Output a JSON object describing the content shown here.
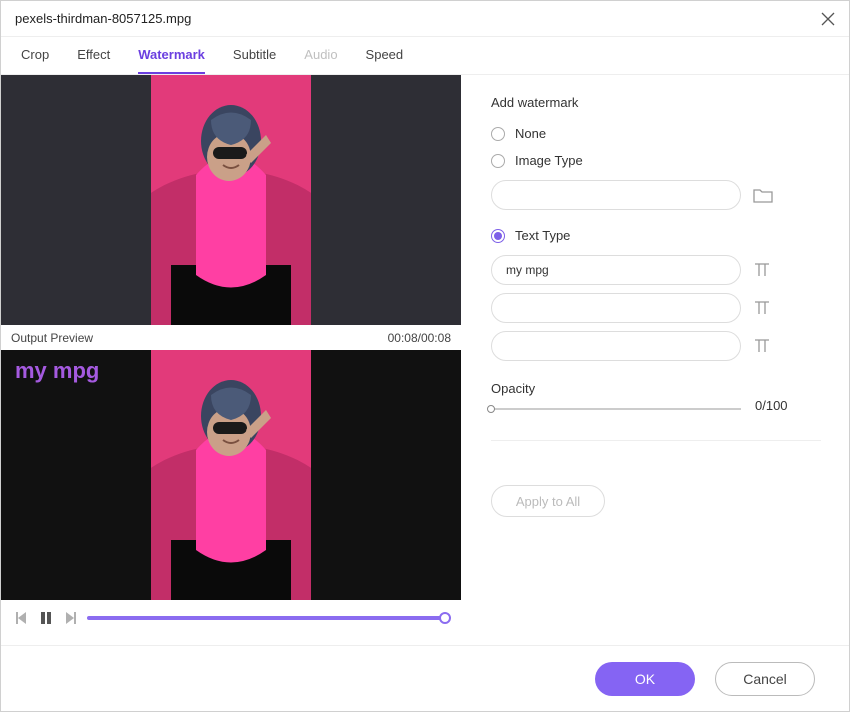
{
  "title": "pexels-thirdman-8057125.mpg",
  "tabs": {
    "crop": "Crop",
    "effect": "Effect",
    "watermark": "Watermark",
    "subtitle": "Subtitle",
    "audio": "Audio",
    "speed": "Speed"
  },
  "preview": {
    "output_label": "Output Preview",
    "time": "00:08/00:08",
    "watermark_text": "my mpg"
  },
  "panel": {
    "section_title": "Add watermark",
    "none_label": "None",
    "image_type_label": "Image Type",
    "text_type_label": "Text Type",
    "text1": "my mpg",
    "text2": "",
    "text3": "",
    "image_path": "",
    "opacity_label": "Opacity",
    "opacity_value": "0/100",
    "apply_all": "Apply to All"
  },
  "footer": {
    "ok": "OK",
    "cancel": "Cancel"
  }
}
